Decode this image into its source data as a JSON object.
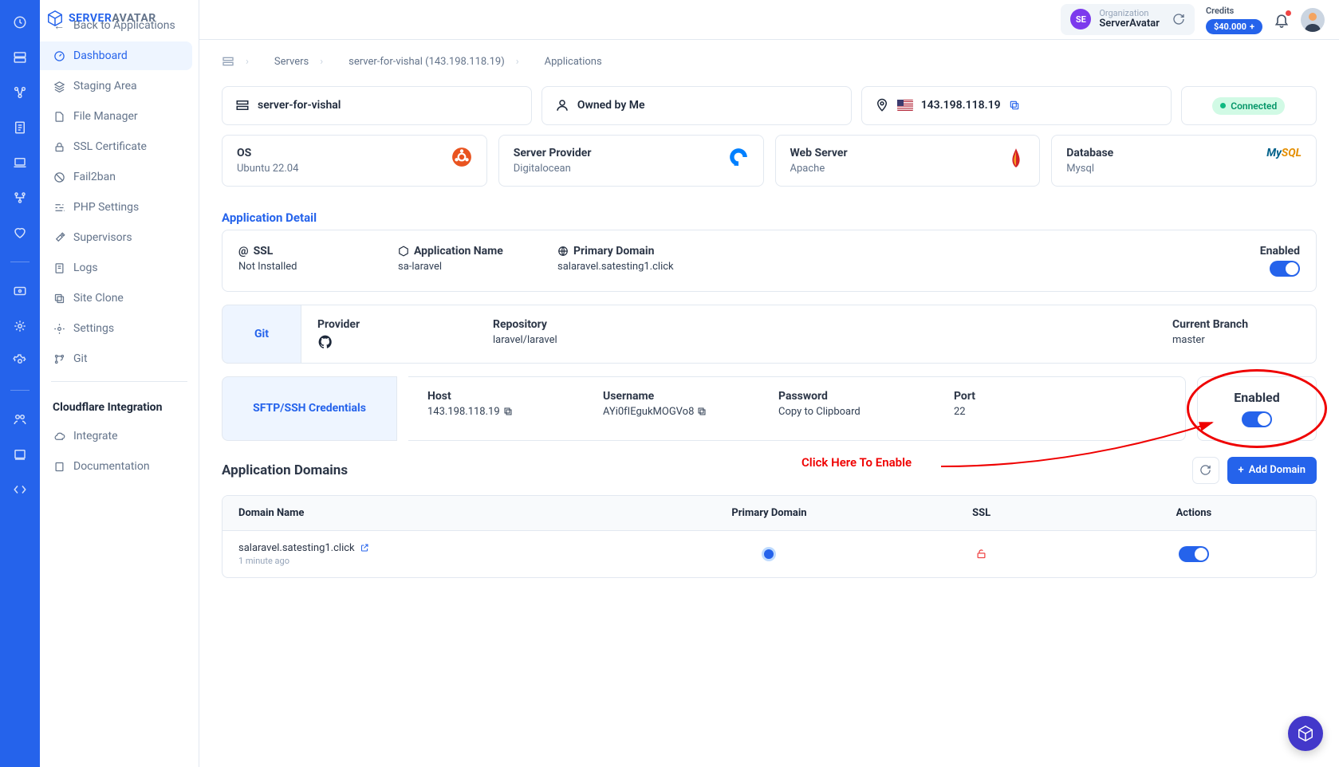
{
  "logo": {
    "part1": "SERVER",
    "part2": "AVATAR"
  },
  "topbar": {
    "org_label": "Organization",
    "org_name": "ServerAvatar",
    "org_initials": "SE",
    "credits_label": "Credits",
    "credits_value": "$40.000",
    "credits_plus": "+"
  },
  "sidebar": {
    "back": "Back to Applications",
    "items": [
      "Dashboard",
      "Staging Area",
      "File Manager",
      "SSL Certificate",
      "Fail2ban",
      "PHP Settings",
      "Supervisors",
      "Logs",
      "Site Clone",
      "Settings",
      "Git"
    ],
    "section": "Cloudflare Integration",
    "cf_items": [
      "Integrate",
      "Documentation"
    ]
  },
  "breadcrumbs": [
    "Servers",
    "server-for-vishal (143.198.118.19)",
    "Applications"
  ],
  "headercards": {
    "server_name": "server-for-vishal",
    "owned": "Owned by Me",
    "ip": "143.198.118.19",
    "status": "Connected"
  },
  "infogrid": {
    "os_label": "OS",
    "os_val": "Ubuntu 22.04",
    "provider_label": "Server Provider",
    "provider_val": "Digitalocean",
    "web_label": "Web Server",
    "web_val": "Apache",
    "db_label": "Database",
    "db_val": "Mysql"
  },
  "appdetail": {
    "title": "Application Detail",
    "ssl_label": "SSL",
    "ssl_val": "Not Installed",
    "appname_label": "Application Name",
    "appname_val": "sa-laravel",
    "domain_label": "Primary Domain",
    "domain_val": "salaravel.satesting1.click",
    "enabled_label": "Enabled"
  },
  "git": {
    "tab": "Git",
    "provider_label": "Provider",
    "repo_label": "Repository",
    "repo_val": "laravel/laravel",
    "branch_label": "Current Branch",
    "branch_val": "master"
  },
  "sftp": {
    "tab": "SFTP/SSH Credentials",
    "host_label": "Host",
    "host_val": "143.198.118.19",
    "user_label": "Username",
    "user_val": "AYi0fIEgukMOGVo8",
    "pass_label": "Password",
    "pass_val": "Copy to Clipboard",
    "port_label": "Port",
    "port_val": "22",
    "enabled_label": "Enabled"
  },
  "annotation": "Click Here To Enable",
  "domains": {
    "title": "Application Domains",
    "add_btn": "Add Domain",
    "cols": [
      "Domain Name",
      "Primary Domain",
      "SSL",
      "Actions"
    ],
    "rows": [
      {
        "name": "salaravel.satesting1.click",
        "time": "1 minute ago",
        "primary": true,
        "ssl": false,
        "action_on": true
      }
    ]
  }
}
